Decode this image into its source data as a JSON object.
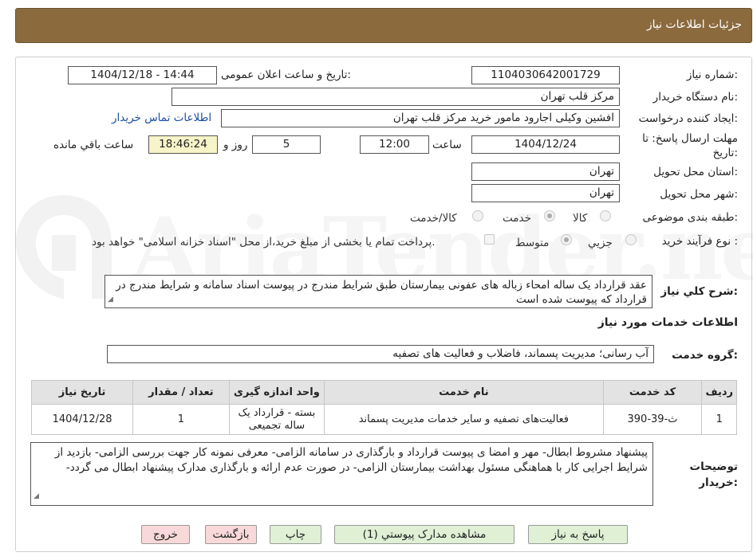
{
  "header": {
    "title": "جزئیات اطلاعات نیاز"
  },
  "form": {
    "need_number_label": "شماره نیاز:",
    "need_number": "1104030642001729",
    "announce_label": "تاریخ و ساعت اعلان عمومی:",
    "announce_value": "1404/12/18 - 14:44",
    "buyer_org_label": "نام دستگاه خریدار:",
    "buyer_org": "مرکز قلب تهران",
    "requester_label": "ایجاد کننده درخواست:",
    "requester": "افشین وکیلی اجارود مامور خرید مرکز قلب تهران",
    "contact_link": "اطلاعات تماس خریدار",
    "deadline_label": "مهلت ارسال پاسخ: تا",
    "deadline_label2": "تاریخ:",
    "deadline_date": "1404/12/24",
    "time_label": "ساعت",
    "deadline_time": "12:00",
    "days_value": "5",
    "days_label": "روز و",
    "remaining_time": "18:46:24",
    "remaining_label": "ساعت باقي مانده",
    "province_label": "استان محل تحویل:",
    "province": "تهران",
    "city_label": "شهر محل تحویل:",
    "city": "تهران",
    "category_label": "طبقه بندی موضوعی:",
    "category_options": [
      "کالا",
      "خدمت",
      "کالا/خدمت"
    ],
    "category_selected": "خدمت",
    "process_label": "نوع فرآیند خرید :",
    "process_options": [
      "جزیي",
      "متوسط"
    ],
    "process_selected": "متوسط",
    "payment_note": "پرداخت تمام یا بخشی از مبلغ خرید،از محل \"اسناد خزانه اسلامی\" خواهد بود.",
    "summary_label": "شرح کلي نیاز:",
    "summary": "عقد قرارداد یک ساله امحاء زباله های عفونی بیمارستان طبق شرایط مندرج در پیوست اسناد سامانه و شرایط مندرج در قرارداد که پیوست شده است"
  },
  "services": {
    "section_title": "اطلاعات خدمات مورد نیاز",
    "group_label": "گروه خدمت:",
    "group_value": "آب رسانی؛ مدیریت پسماند، فاضلاب و فعالیت های تصفیه",
    "table": {
      "headers": [
        "ردیف",
        "کد خدمت",
        "نام خدمت",
        "واحد اندازه گیری",
        "تعداد / مقدار",
        "تاریخ نیاز"
      ],
      "rows": [
        [
          "1",
          "ث-39-390",
          "فعالیت‌های تصفیه و سایر خدمات مدیریت پسماند",
          "بسته - قرارداد یک ساله تجمیعی",
          "1",
          "1404/12/28"
        ]
      ]
    }
  },
  "buyer_notes": {
    "label": "توضیحات خریدار:",
    "text": "پیشنهاد مشروط ابطال- مهر و امضا ی پیوست قرارداد و بارگذاری در سامانه الزامی- معرفی نمونه کار جهت بررسی الزامی- بازدید از شرایط اجرایی کار با هماهنگی مسئول بهداشت بیمارستان الزامی- در صورت عدم ارائه و بارگذاری مدارک پیشنهاد ابطال می گردد-"
  },
  "actions": {
    "reply": "پاسخ به نیاز",
    "attachments": "مشاهده مدارک پیوستي (1)",
    "print": "چاپ",
    "back": "بازگشت",
    "exit": "خروج"
  },
  "watermark": {
    "text": "AriaTender.neT"
  },
  "colors": {
    "header_bg": "#8b6a3e",
    "link": "#1a4fa0",
    "remaining_bg": "#f6f4c8",
    "green_btn": "#dff0d5",
    "pink_btn": "#f8d8d8"
  }
}
